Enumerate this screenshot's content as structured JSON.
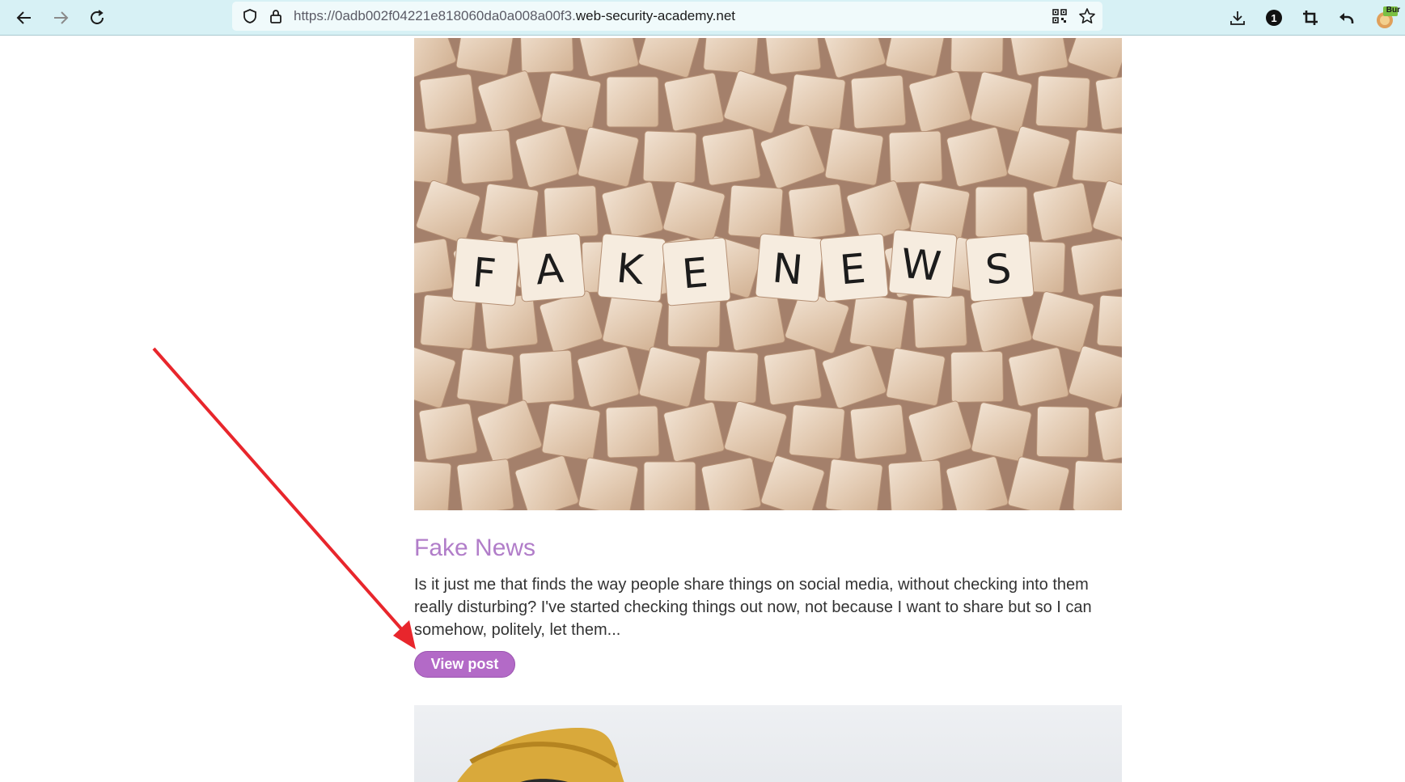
{
  "browser": {
    "url_prefix": "https://0adb002f04221e818060da0a008a00f3.",
    "url_domain": "web-security-academy.net",
    "extension_badge": "Bur",
    "icons": {
      "back": "arrow-left-icon",
      "forward": "arrow-right-icon",
      "reload": "reload-icon",
      "shield": "shield-icon",
      "lock": "lock-icon",
      "qr": "qr-code-icon",
      "bookmark": "star-icon",
      "download": "download-icon",
      "password": "password-manager-icon",
      "crop": "crop-icon",
      "undo": "undo-icon",
      "extension": "burp-extension-icon"
    }
  },
  "post": {
    "image_tiles": [
      "F",
      "A",
      "K",
      "E",
      "N",
      "E",
      "W",
      "S"
    ],
    "title": "Fake News",
    "summary": "Is it just me that finds the way people share things on social media, without checking into them really disturbing? I've started checking things out now, not because I want to share but so I can somehow, politely, let them...",
    "button_label": "View post"
  },
  "colors": {
    "title": "#b17dc9",
    "button": "#b36ac7",
    "annotation_arrow": "#e8262c"
  }
}
